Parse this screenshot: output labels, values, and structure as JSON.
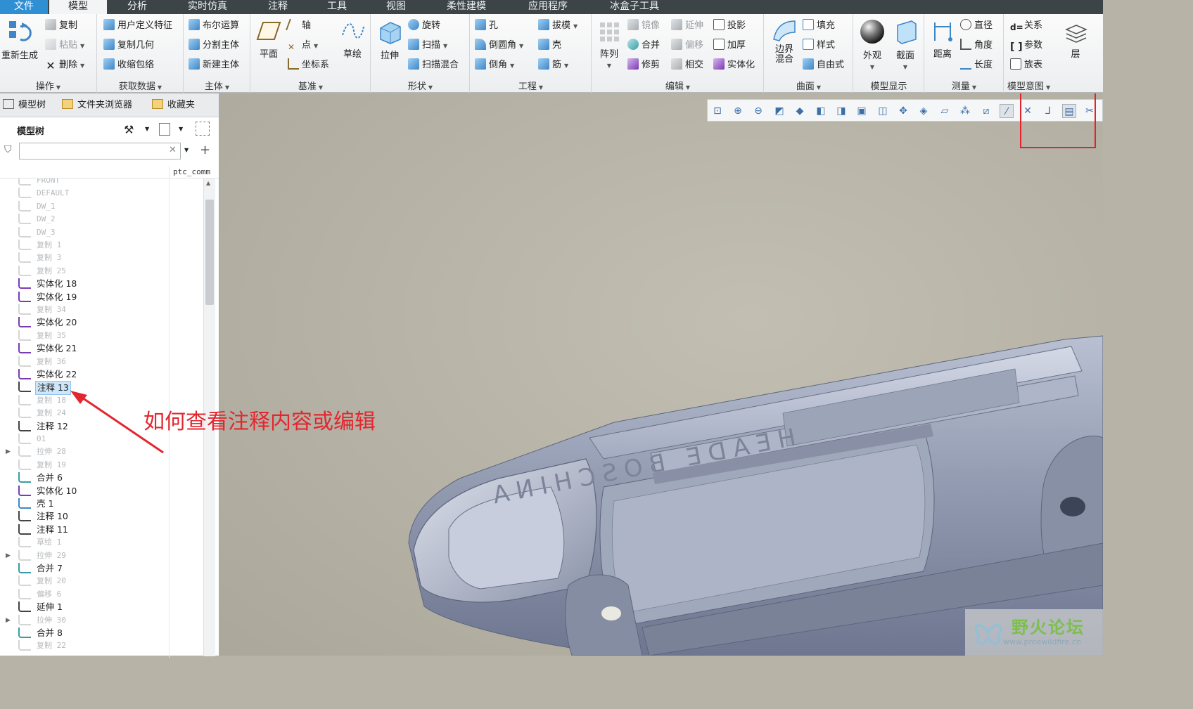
{
  "menu": {
    "tabs": [
      "文件",
      "模型",
      "分析",
      "实时仿真",
      "注释",
      "工具",
      "视图",
      "柔性建模",
      "应用程序",
      "冰盒子工具"
    ],
    "active": "模型"
  },
  "ribbon": {
    "operations": {
      "label": "操作",
      "regenerate": "重新生成",
      "copy": "复制",
      "paste": "粘贴",
      "delete": "删除"
    },
    "get_data": {
      "label": "获取数据",
      "udf": "用户定义特征",
      "copy_geom": "复制几何",
      "shrinkwrap": "收缩包络"
    },
    "body": {
      "label": "主体",
      "boolean": "布尔运算",
      "split": "分割主体",
      "new_body": "新建主体"
    },
    "datum": {
      "label": "基准",
      "plane": "平面",
      "axis": "轴",
      "point": "点",
      "csys": "坐标系",
      "sketch": "草绘"
    },
    "shapes": {
      "label": "形状",
      "extrude": "拉伸",
      "revolve": "旋转",
      "sweep": "扫描",
      "swept_blend": "扫描混合"
    },
    "engineering": {
      "label": "工程",
      "hole": "孔",
      "round": "倒圆角",
      "chamfer": "倒角",
      "draft": "拔模",
      "shell": "壳",
      "rib": "筋"
    },
    "editing": {
      "label": "编辑",
      "pattern": "阵列",
      "mirror": "镜像",
      "merge": "合并",
      "trim": "修剪",
      "extend": "延伸",
      "offset": "偏移",
      "intersect": "相交",
      "project": "投影",
      "thicken": "加厚",
      "solidify": "实体化"
    },
    "surfaces": {
      "label": "曲面",
      "boundary_blend": "边界混合",
      "fill": "填充",
      "style": "样式",
      "freestyle": "自由式"
    },
    "model_display": {
      "label": "模型显示",
      "appearance": "外观",
      "section": "截面"
    },
    "measure": {
      "label": "测量",
      "distance": "距离",
      "diameter": "直径",
      "angle": "角度",
      "length": "长度"
    },
    "model_intent": {
      "label": "模型意图",
      "relations": "关系",
      "parameters": "参数",
      "family_table": "族表",
      "layers": "层"
    }
  },
  "left_panel": {
    "tabs": [
      "模型树",
      "文件夹浏览器",
      "收藏夹"
    ],
    "tree_title": "模型树",
    "filter_placeholder": "",
    "column_header": "ptc_comm",
    "items": [
      {
        "label": "FRONT",
        "dim": true
      },
      {
        "label": "DEFAULT",
        "dim": true
      },
      {
        "label": "DW_1",
        "dim": true
      },
      {
        "label": "DW_2",
        "dim": true
      },
      {
        "label": "DW_3",
        "dim": true
      },
      {
        "label": "复制 1",
        "dim": true
      },
      {
        "label": "复制 3",
        "dim": true
      },
      {
        "label": "复制 25",
        "dim": true
      },
      {
        "label": "实体化 18",
        "dim": false
      },
      {
        "label": "实体化 19",
        "dim": false
      },
      {
        "label": "复制 34",
        "dim": true
      },
      {
        "label": "实体化 20",
        "dim": false
      },
      {
        "label": "复制 35",
        "dim": true
      },
      {
        "label": "实体化 21",
        "dim": false
      },
      {
        "label": "复制 36",
        "dim": true
      },
      {
        "label": "实体化 22",
        "dim": false
      },
      {
        "label": "注释 13",
        "dim": false,
        "selected": true
      },
      {
        "label": "复制 18",
        "dim": true
      },
      {
        "label": "复制 24",
        "dim": true
      },
      {
        "label": "注释 12",
        "dim": false
      },
      {
        "label": "01",
        "dim": true
      },
      {
        "label": "拉伸 28",
        "dim": true,
        "expandable": true
      },
      {
        "label": "复制 19",
        "dim": true
      },
      {
        "label": "合并 6",
        "dim": false
      },
      {
        "label": "实体化 10",
        "dim": false
      },
      {
        "label": "壳 1",
        "dim": false
      },
      {
        "label": "注释 10",
        "dim": false
      },
      {
        "label": "注释 11",
        "dim": false
      },
      {
        "label": "草绘 1",
        "dim": true
      },
      {
        "label": "拉伸 29",
        "dim": true,
        "expandable": true
      },
      {
        "label": "合并 7",
        "dim": false
      },
      {
        "label": "复制 20",
        "dim": true
      },
      {
        "label": "偏移 6",
        "dim": true
      },
      {
        "label": "延伸 1",
        "dim": false
      },
      {
        "label": "拉伸 30",
        "dim": true,
        "expandable": true
      },
      {
        "label": "合并 8",
        "dim": false
      },
      {
        "label": "复制 22",
        "dim": true
      }
    ]
  },
  "annotation": {
    "text": "如何查看注释内容或编辑",
    "color": "#e3262f"
  },
  "watermark": {
    "title": "野火论坛",
    "url": "www.proewildfire.cn"
  },
  "colors": {
    "menubar": "#3d4448",
    "file_tab": "#2f8fd3",
    "viewport": "#b7b3a6",
    "model": "#8e97ad",
    "selection": "#cde6fa"
  }
}
